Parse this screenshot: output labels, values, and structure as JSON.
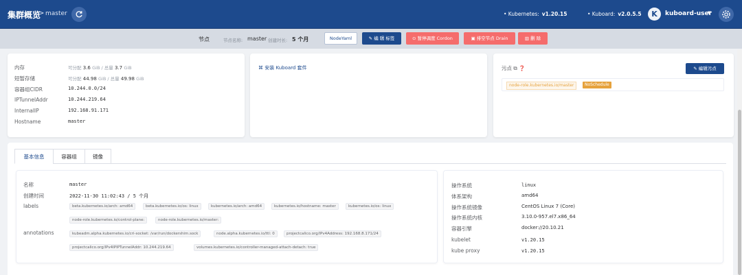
{
  "header": {
    "title": "集群概览",
    "breadcrumb_sep": ">",
    "breadcrumb": "master",
    "kubernetes_label": "• Kubernetes:",
    "kubernetes_version": "v1.20.15",
    "kuboard_label": "• Kuboard:",
    "kuboard_version": "v2.0.5.5",
    "avatar_letter": "K",
    "user": "kuboard-user",
    "user_caret": "▼"
  },
  "toolbar": {
    "title": "节点",
    "name_label": "节点名称:",
    "name_value": "master",
    "age_label": "创建时长:",
    "age_value": "5 个月",
    "buttons": {
      "nodeyaml": "NodeYaml",
      "edit_labels": "编 辑 标签",
      "cordon": "暂停调度 Cordon",
      "drain": "排空节点 Drain",
      "delete": "删 除"
    }
  },
  "resources": [
    {
      "label": "内存",
      "prefix": "可分配",
      "alloc": "3.6",
      "unit1": "GiB / 总量",
      "total": "3.7",
      "unit2": "GiB"
    },
    {
      "label": "短暂存储",
      "prefix": "可分配",
      "alloc": "44.98",
      "unit1": "GiB / 总量",
      "total": "49.98",
      "unit2": "GiB"
    }
  ],
  "node_addr": [
    {
      "label": "容器组CIDR",
      "value": "10.244.0.0/24"
    },
    {
      "label": "IPTunnelAddr",
      "value": "10.244.219.64"
    },
    {
      "label": "InternalIP",
      "value": "192.168.91.171"
    },
    {
      "label": "Hostname",
      "value": "master"
    }
  ],
  "install_link": "安装 Kuboard 套件",
  "taints": {
    "title": "污点",
    "edit_button": "编辑污点",
    "key": "node-role.kubernetes.io/master",
    "effect": "NoSchedule"
  },
  "tabs": [
    "基本信息",
    "容器组",
    "镜像"
  ],
  "basic_info": {
    "name_label": "名称",
    "name_value": "master",
    "created_label": "创建时间",
    "created_value": "2022-11-30 11:02:43  /  5 个月",
    "labels_label": "labels",
    "labels": [
      "beta.kubernetes.io/arch: amd64",
      "beta.kubernetes.io/os: linux",
      "kubernetes.io/arch: amd64",
      "kubernetes.io/hostname: master",
      "kubernetes.io/os: linux",
      "node-role.kubernetes.io/control-plane:",
      "node-role.kubernetes.io/master:"
    ],
    "annotations_label": "annotations",
    "annotations": [
      "kubeadm.alpha.kubernetes.io/cri-socket: /var/run/dockershim.sock",
      "node.alpha.kubernetes.io/ttl: 0",
      "projectcalico.org/IPv4Address: 192.168.8.171/24",
      "projectcalico.org/IPv4IPIPTunnelAddr: 10.244.219.64",
      "volumes.kubernetes.io/controller-managed-attach-detach: true"
    ]
  },
  "system_info": [
    {
      "label": "操作系统",
      "value": "linux"
    },
    {
      "label": "体系架构",
      "value": "amd64"
    },
    {
      "label": "操作系统镜像",
      "value": "CentOS Linux 7 (Core)"
    },
    {
      "label": "操作系统内核",
      "value": "3.10.0-957.el7.x86_64"
    },
    {
      "label": "容器引擎",
      "value": "docker://20.10.21"
    },
    {
      "label": "kubelet",
      "value": "v1.20.15"
    },
    {
      "label": "kube proxy",
      "value": "v1.20.15"
    }
  ],
  "colors": {
    "header_bg": "#1d4a8d",
    "danger": "#f56c6c",
    "warning": "#e6a23c",
    "page_bg": "#f0f2f5"
  }
}
